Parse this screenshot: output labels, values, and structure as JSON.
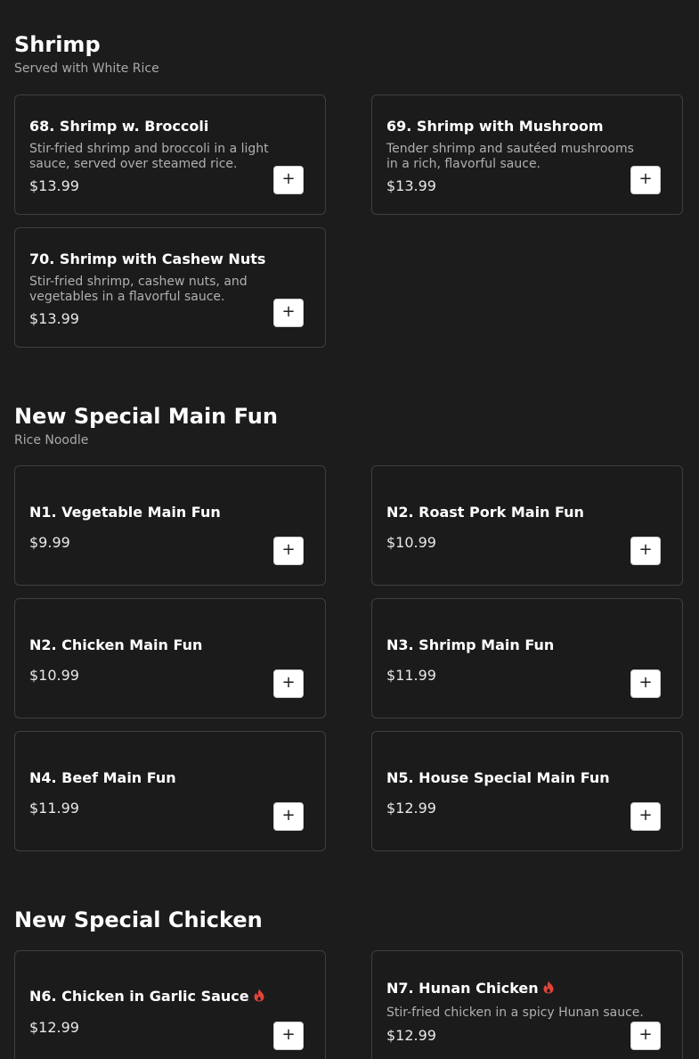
{
  "accent_colors": {
    "background": "#1c1c1c",
    "card_border": "#3f3f42",
    "spicy": "#e0443a",
    "add_button_bg": "#ffffff"
  },
  "add_button_label": "+",
  "sections": [
    {
      "title": "Shrimp",
      "subtitle": "Served with White Rice",
      "items": [
        {
          "name": "68. Shrimp w. Broccoli",
          "description": "Stir-fried shrimp and broccoli in a light sauce, served over steamed rice.",
          "price": "$13.99"
        },
        {
          "name": "69. Shrimp with Mushroom",
          "description": "Tender shrimp and sautéed mushrooms in a rich, flavorful sauce.",
          "price": "$13.99"
        },
        {
          "name": "70. Shrimp with Cashew Nuts",
          "description": "Stir-fried shrimp, cashew nuts, and vegetables in a flavorful sauce.",
          "price": "$13.99"
        }
      ]
    },
    {
      "title": "New Special Main Fun",
      "subtitle": "Rice Noodle",
      "items": [
        {
          "name": "N1. Vegetable Main Fun",
          "price": "$9.99"
        },
        {
          "name": "N2. Roast Pork Main Fun",
          "price": "$10.99"
        },
        {
          "name": "N2. Chicken Main Fun",
          "price": "$10.99"
        },
        {
          "name": "N3. Shrimp Main Fun",
          "price": "$11.99"
        },
        {
          "name": "N4. Beef Main Fun",
          "price": "$11.99"
        },
        {
          "name": "N5. House Special Main Fun",
          "price": "$12.99"
        }
      ]
    },
    {
      "title": "New Special Chicken",
      "items": [
        {
          "name": "N6. Chicken in Garlic Sauce",
          "price": "$12.99",
          "spicy": true,
          "icon": "spicy-flame-icon"
        },
        {
          "name": "N7. Hunan Chicken",
          "description": "Stir-fried chicken in a spicy Hunan sauce.",
          "price": "$12.99",
          "spicy": true,
          "icon": "spicy-flame-icon"
        }
      ]
    }
  ]
}
